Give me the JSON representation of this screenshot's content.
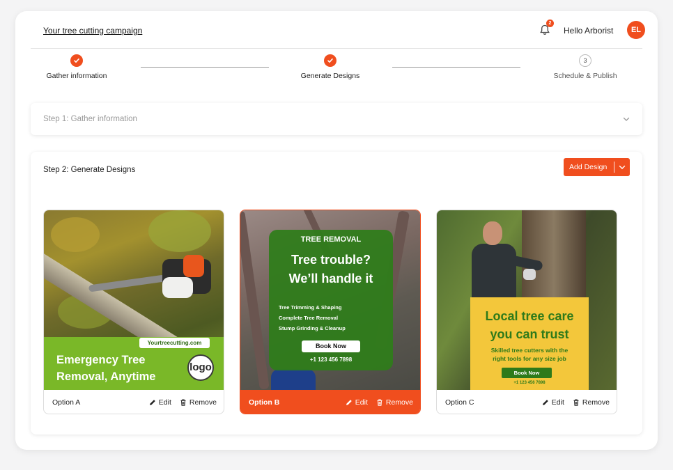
{
  "header": {
    "campaign_title": "Your tree cutting campaign",
    "notification_count": "2",
    "greeting": "Hello Arborist",
    "avatar_initials": "EL"
  },
  "stepper": {
    "steps": [
      {
        "label": "Gather information",
        "state": "done"
      },
      {
        "label": "Generate Designs",
        "state": "done"
      },
      {
        "label": "Schedule & Publish",
        "state": "pending",
        "number": "3"
      }
    ]
  },
  "step1": {
    "title": "Step 1: Gather information"
  },
  "step2": {
    "title": "Step 2: Generate Designs",
    "add_design_label": "Add Design",
    "cards": [
      {
        "option": "Option A",
        "selected": false,
        "edit": "Edit",
        "remove": "Remove",
        "ad": {
          "url": "Yourtreecutting.com",
          "headline_line1": "Emergency Tree",
          "headline_line2": "Removal, Anytime",
          "logo": "logo"
        }
      },
      {
        "option": "Option B",
        "selected": true,
        "edit": "Edit",
        "remove": "Remove",
        "ad": {
          "tag": "TREE REMOVAL",
          "headline_line1": "Tree trouble?",
          "headline_line2": "We’ll handle it",
          "services": [
            "Tree Trimming & Shaping",
            "Complete Tree Removal",
            "Stump Grinding & Cleanup"
          ],
          "cta": "Book Now",
          "phone": "+1 123 456 7898"
        }
      },
      {
        "option": "Option C",
        "selected": false,
        "edit": "Edit",
        "remove": "Remove",
        "ad": {
          "headline_line1": "Local tree care",
          "headline_line2": "you can trust",
          "sub_line1": "Skilled tree cutters with the",
          "sub_line2": "right tools for any size job",
          "cta": "Book Now",
          "phone": "+1 123 456 7898"
        }
      }
    ]
  },
  "colors": {
    "accent": "#f04e1e",
    "green": "#2e7d1a",
    "lime": "#7ab828",
    "yellow": "#f3c73b"
  }
}
